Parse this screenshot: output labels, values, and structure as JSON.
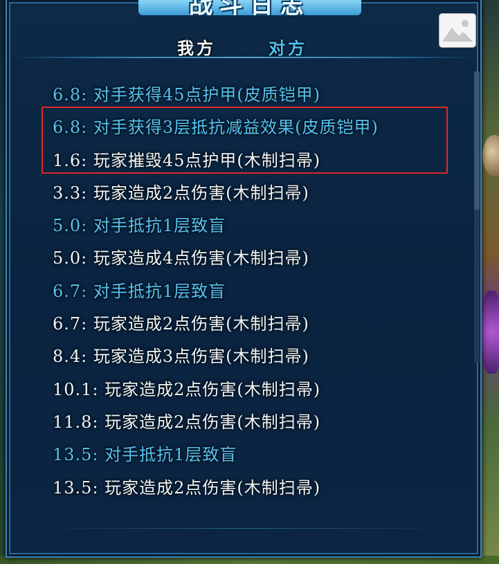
{
  "title": "战斗日志",
  "tabs": [
    {
      "label": "我方",
      "active": true
    },
    {
      "label": "对方",
      "active": false
    }
  ],
  "icons": {
    "corner": "image-icon"
  },
  "colors": {
    "opponent_text": "#56c3ef",
    "player_text": "#f2f6f8",
    "highlight": "#e0262b"
  },
  "log": [
    {
      "text": "6.8: 对手获得45点护甲(皮质铠甲)",
      "actor": "opponent"
    },
    {
      "text": "6.8: 对手获得3层抵抗减益效果(皮质铠甲)",
      "actor": "opponent"
    },
    {
      "text": "1.6: 玩家摧毁45点护甲(木制扫帚)",
      "actor": "player"
    },
    {
      "text": "3.3: 玩家造成2点伤害(木制扫帚)",
      "actor": "player"
    },
    {
      "text": "5.0: 对手抵抗1层致盲",
      "actor": "opponent"
    },
    {
      "text": "5.0: 玩家造成4点伤害(木制扫帚)",
      "actor": "player"
    },
    {
      "text": "6.7: 对手抵抗1层致盲",
      "actor": "opponent"
    },
    {
      "text": "6.7: 玩家造成2点伤害(木制扫帚)",
      "actor": "player"
    },
    {
      "text": "8.4: 玩家造成3点伤害(木制扫帚)",
      "actor": "player"
    },
    {
      "text": "10.1: 玩家造成2点伤害(木制扫帚)",
      "actor": "player"
    },
    {
      "text": "11.8: 玩家造成2点伤害(木制扫帚)",
      "actor": "player"
    },
    {
      "text": "13.5: 对手抵抗1层致盲",
      "actor": "opponent"
    },
    {
      "text": "13.5: 玩家造成2点伤害(木制扫帚)",
      "actor": "player"
    }
  ]
}
